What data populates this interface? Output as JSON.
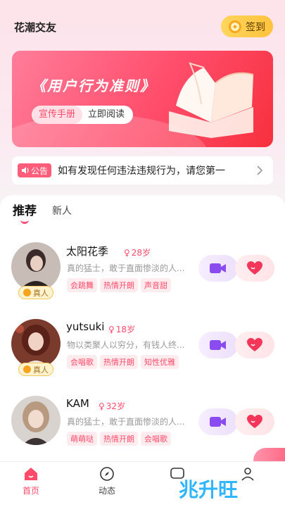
{
  "header": {
    "app_title": "花潮交友",
    "checkin_label": "签到"
  },
  "banner": {
    "title": "《用户行为准则》",
    "pill_left": "宣传手册",
    "pill_right": "立即阅读"
  },
  "notice": {
    "tag": "公告",
    "text": "如有发现任何违法违规行为，请您第一"
  },
  "tabs": [
    {
      "label": "推荐",
      "active": true
    },
    {
      "label": "新人",
      "active": false
    }
  ],
  "users": [
    {
      "name": "太阳花季",
      "age": "28岁",
      "bio": "真的猛士，敢于直面惨淡的人...",
      "verified_label": "真人",
      "tags": [
        "会跳舞",
        "热情开朗",
        "声音甜"
      ]
    },
    {
      "name": "yutsuki",
      "age": "18岁",
      "bio": "物以类聚人以穷分，有钱人终...",
      "verified_label": "真人",
      "tags": [
        "会唱歌",
        "热情开朗",
        "知性优雅"
      ]
    },
    {
      "name": "KAM",
      "age": "32岁",
      "bio": "真的猛士，敢于直面惨淡的人...",
      "verified_label": "",
      "tags": [
        "萌萌哒",
        "热情开朗",
        "会唱歌"
      ]
    }
  ],
  "bottom_nav": [
    {
      "label": "首页",
      "icon": "home-icon",
      "active": true
    },
    {
      "label": "动态",
      "icon": "compass-icon",
      "active": false
    },
    {
      "label": "",
      "icon": "message-icon",
      "active": false
    },
    {
      "label": "",
      "icon": "profile-icon",
      "active": false
    }
  ],
  "watermark": "兆升旺",
  "colors": {
    "accent": "#ff4a6a",
    "checkin": "#ffc23d"
  }
}
